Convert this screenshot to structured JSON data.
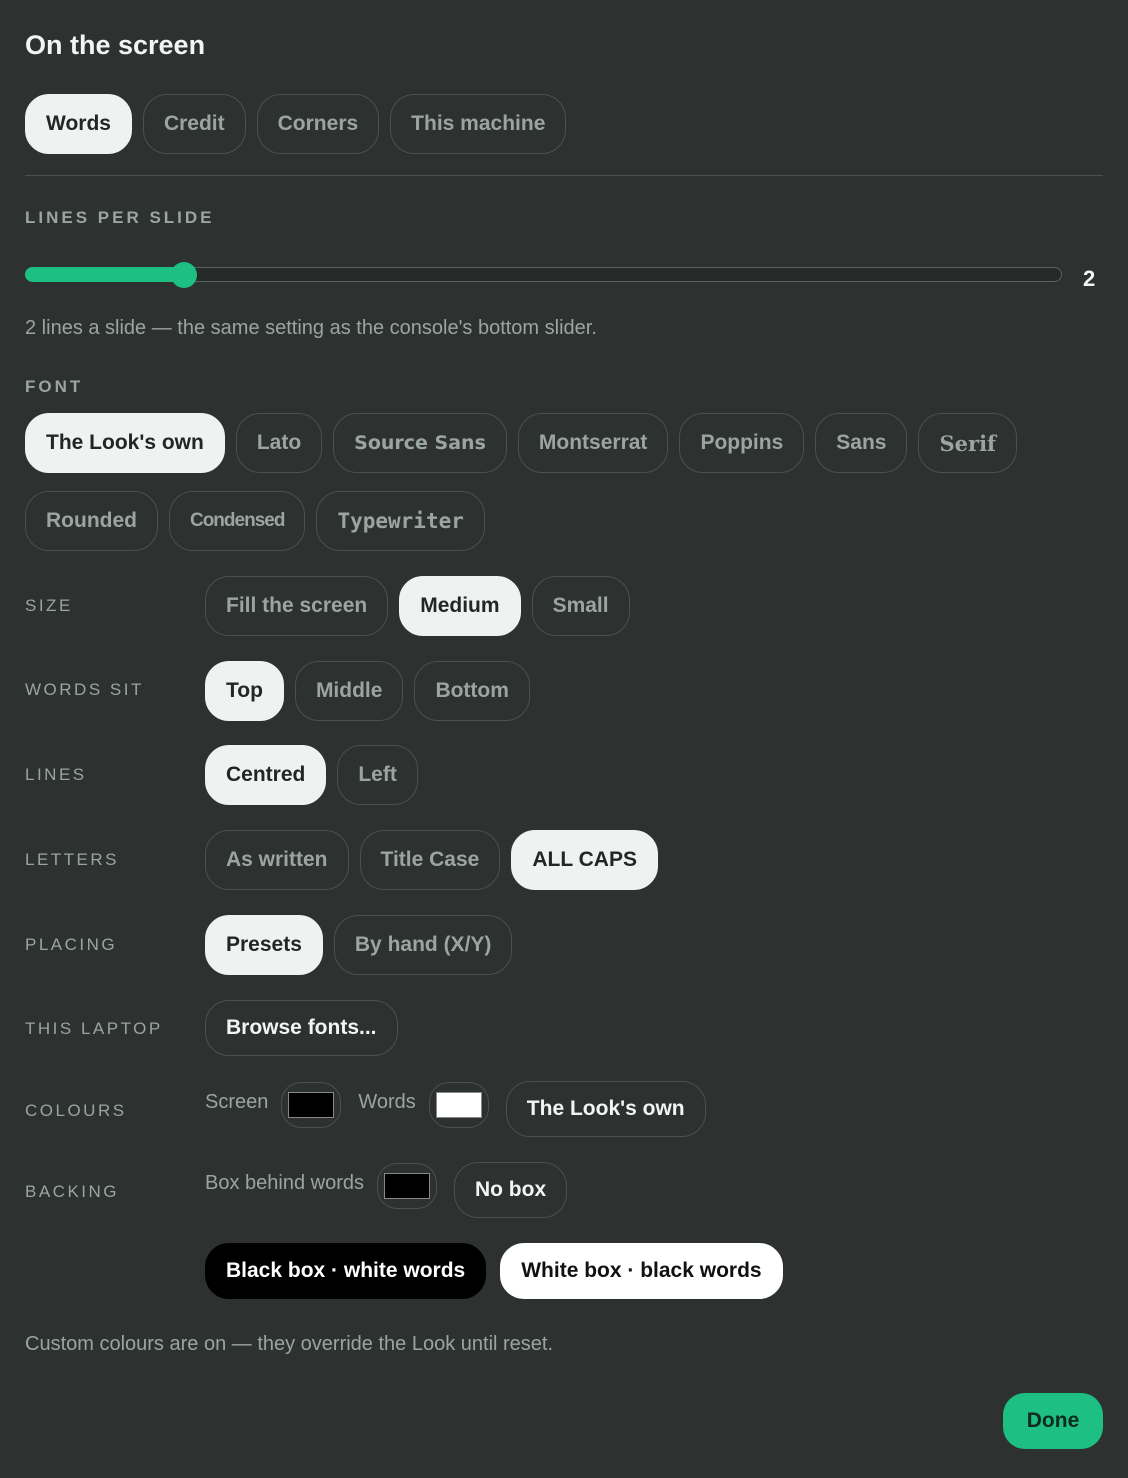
{
  "title": "On the screen",
  "tabs": [
    {
      "label": "Words",
      "selected": true
    },
    {
      "label": "Credit",
      "selected": false
    },
    {
      "label": "Corners",
      "selected": false
    },
    {
      "label": "This machine",
      "selected": false
    }
  ],
  "lines_per_slide": {
    "label": "LINES PER SLIDE",
    "value": 2,
    "value_text": "2",
    "fill_fraction": 0.153,
    "accent": "#1dbf82",
    "hint": "2 lines a slide — the same setting as the console's bottom slider."
  },
  "font": {
    "label": "FONT",
    "options": [
      {
        "label": "The Look's own",
        "selected": true
      },
      {
        "label": "Lato"
      },
      {
        "label": "Source Sans"
      },
      {
        "label": "Montserrat"
      },
      {
        "label": "Poppins"
      },
      {
        "label": "Sans"
      },
      {
        "label": "Serif"
      },
      {
        "label": "Rounded"
      },
      {
        "label": "Condensed"
      },
      {
        "label": "Typewriter"
      }
    ]
  },
  "size": {
    "label": "SIZE",
    "options": [
      "Fill the screen",
      "Medium",
      "Small"
    ],
    "selected": "Medium"
  },
  "words_sit": {
    "label": "WORDS SIT",
    "options": [
      "Top",
      "Middle",
      "Bottom"
    ],
    "selected": "Top"
  },
  "lines": {
    "label": "LINES",
    "options": [
      "Centred",
      "Left"
    ],
    "selected": "Centred"
  },
  "letters": {
    "label": "LETTERS",
    "options": [
      "As written",
      "Title Case",
      "ALL CAPS"
    ],
    "selected": "ALL CAPS"
  },
  "placing": {
    "label": "PLACING",
    "options": [
      "Presets",
      "By hand (X/Y)"
    ],
    "selected": "Presets"
  },
  "this_laptop": {
    "label": "THIS LAPTOP",
    "browse_label": "Browse fonts..."
  },
  "colours": {
    "label": "COLOURS",
    "screen_label": "Screen",
    "screen_color": "#000000",
    "words_label": "Words",
    "words_color": "#ffffff",
    "reset_label": "The Look's own"
  },
  "backing": {
    "label": "BACKING",
    "box_label": "Box behind words",
    "box_color": "#000000",
    "no_box_label": "No box",
    "black_box_label": "Black box · white words",
    "white_box_label": "White box · black words"
  },
  "custom_note": "Custom colours are on — they override the Look until reset.",
  "done_label": "Done"
}
